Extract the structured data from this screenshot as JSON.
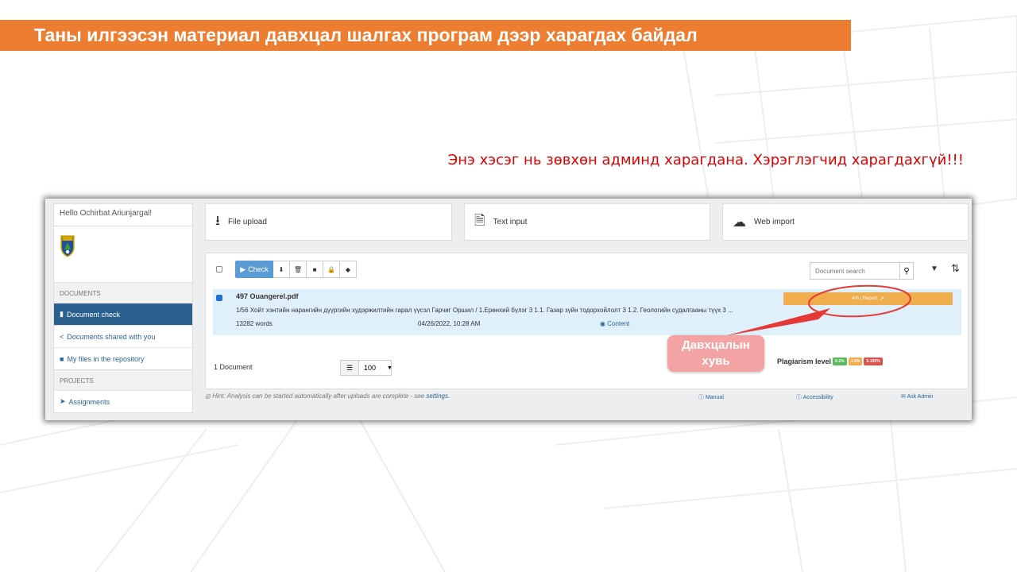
{
  "slide": {
    "title": "Таны илгээсэн материал давхцал шалгах програм дээр харагдах байдал",
    "notice": "Энэ хэсэг нь зөвхөн админд харагдана. Хэрэглэгчид харагдахгүй!!!",
    "callout_line1": "Давхцалын",
    "callout_line2": "хувь",
    "colors": {
      "title_bar": "#ed7d31",
      "notice": "#e00000",
      "callout": "#f3a3a3",
      "annotation": "#e53935"
    }
  },
  "sidebar": {
    "greeting": "Hello Ochirbat Ariunjargal!",
    "section_documents": "DOCUMENTS",
    "items": [
      {
        "label": "Document check",
        "icon": "file-icon",
        "active": true
      },
      {
        "label": "Documents shared with you",
        "icon": "share-icon",
        "active": false
      },
      {
        "label": "My files in the repository",
        "icon": "book-icon",
        "active": false
      }
    ],
    "section_projects": "PROJECTS",
    "projects_items": [
      {
        "label": "Assignments",
        "icon": "send-icon"
      }
    ]
  },
  "upload": {
    "file_upload": "File upload",
    "text_input": "Text input",
    "web_import": "Web import"
  },
  "toolbar": {
    "check_label": "Check",
    "search_placeholder": "Document search"
  },
  "document": {
    "name": "497 Ouangerel.pdf",
    "excerpt": "1/56 Хойт хэнтийн нарангийн дүүргийн худэржилтийн гарал үүсэл Гарчиг Оршил / 1.Ерөнхий бүлэг 3 1.1. Газар зүйн тодорхойлолт 3 1.2. Геологийн судалгааны түүх 3 ...",
    "words": "13282  words",
    "date": "04/26/2022, 10:28 AM",
    "content_link": "Content",
    "report": "4% | Report"
  },
  "list": {
    "count": "1 Document",
    "per_page": "100"
  },
  "plagiarism": {
    "label": "Plagiarism level",
    "levels": [
      {
        "label": "0-1%",
        "color": "#5cb85c"
      },
      {
        "label": "1-5%",
        "color": "#f0ad4e"
      },
      {
        "label": "5-100%",
        "color": "#d9534f"
      }
    ]
  },
  "footer": {
    "hint_text": "Hint: Analysis can be started automatically after uploads are complete - see",
    "hint_link": "settings.",
    "manual": "Manual",
    "accessibility": "Accessibility",
    "ask_admin": "Ask Admin"
  }
}
